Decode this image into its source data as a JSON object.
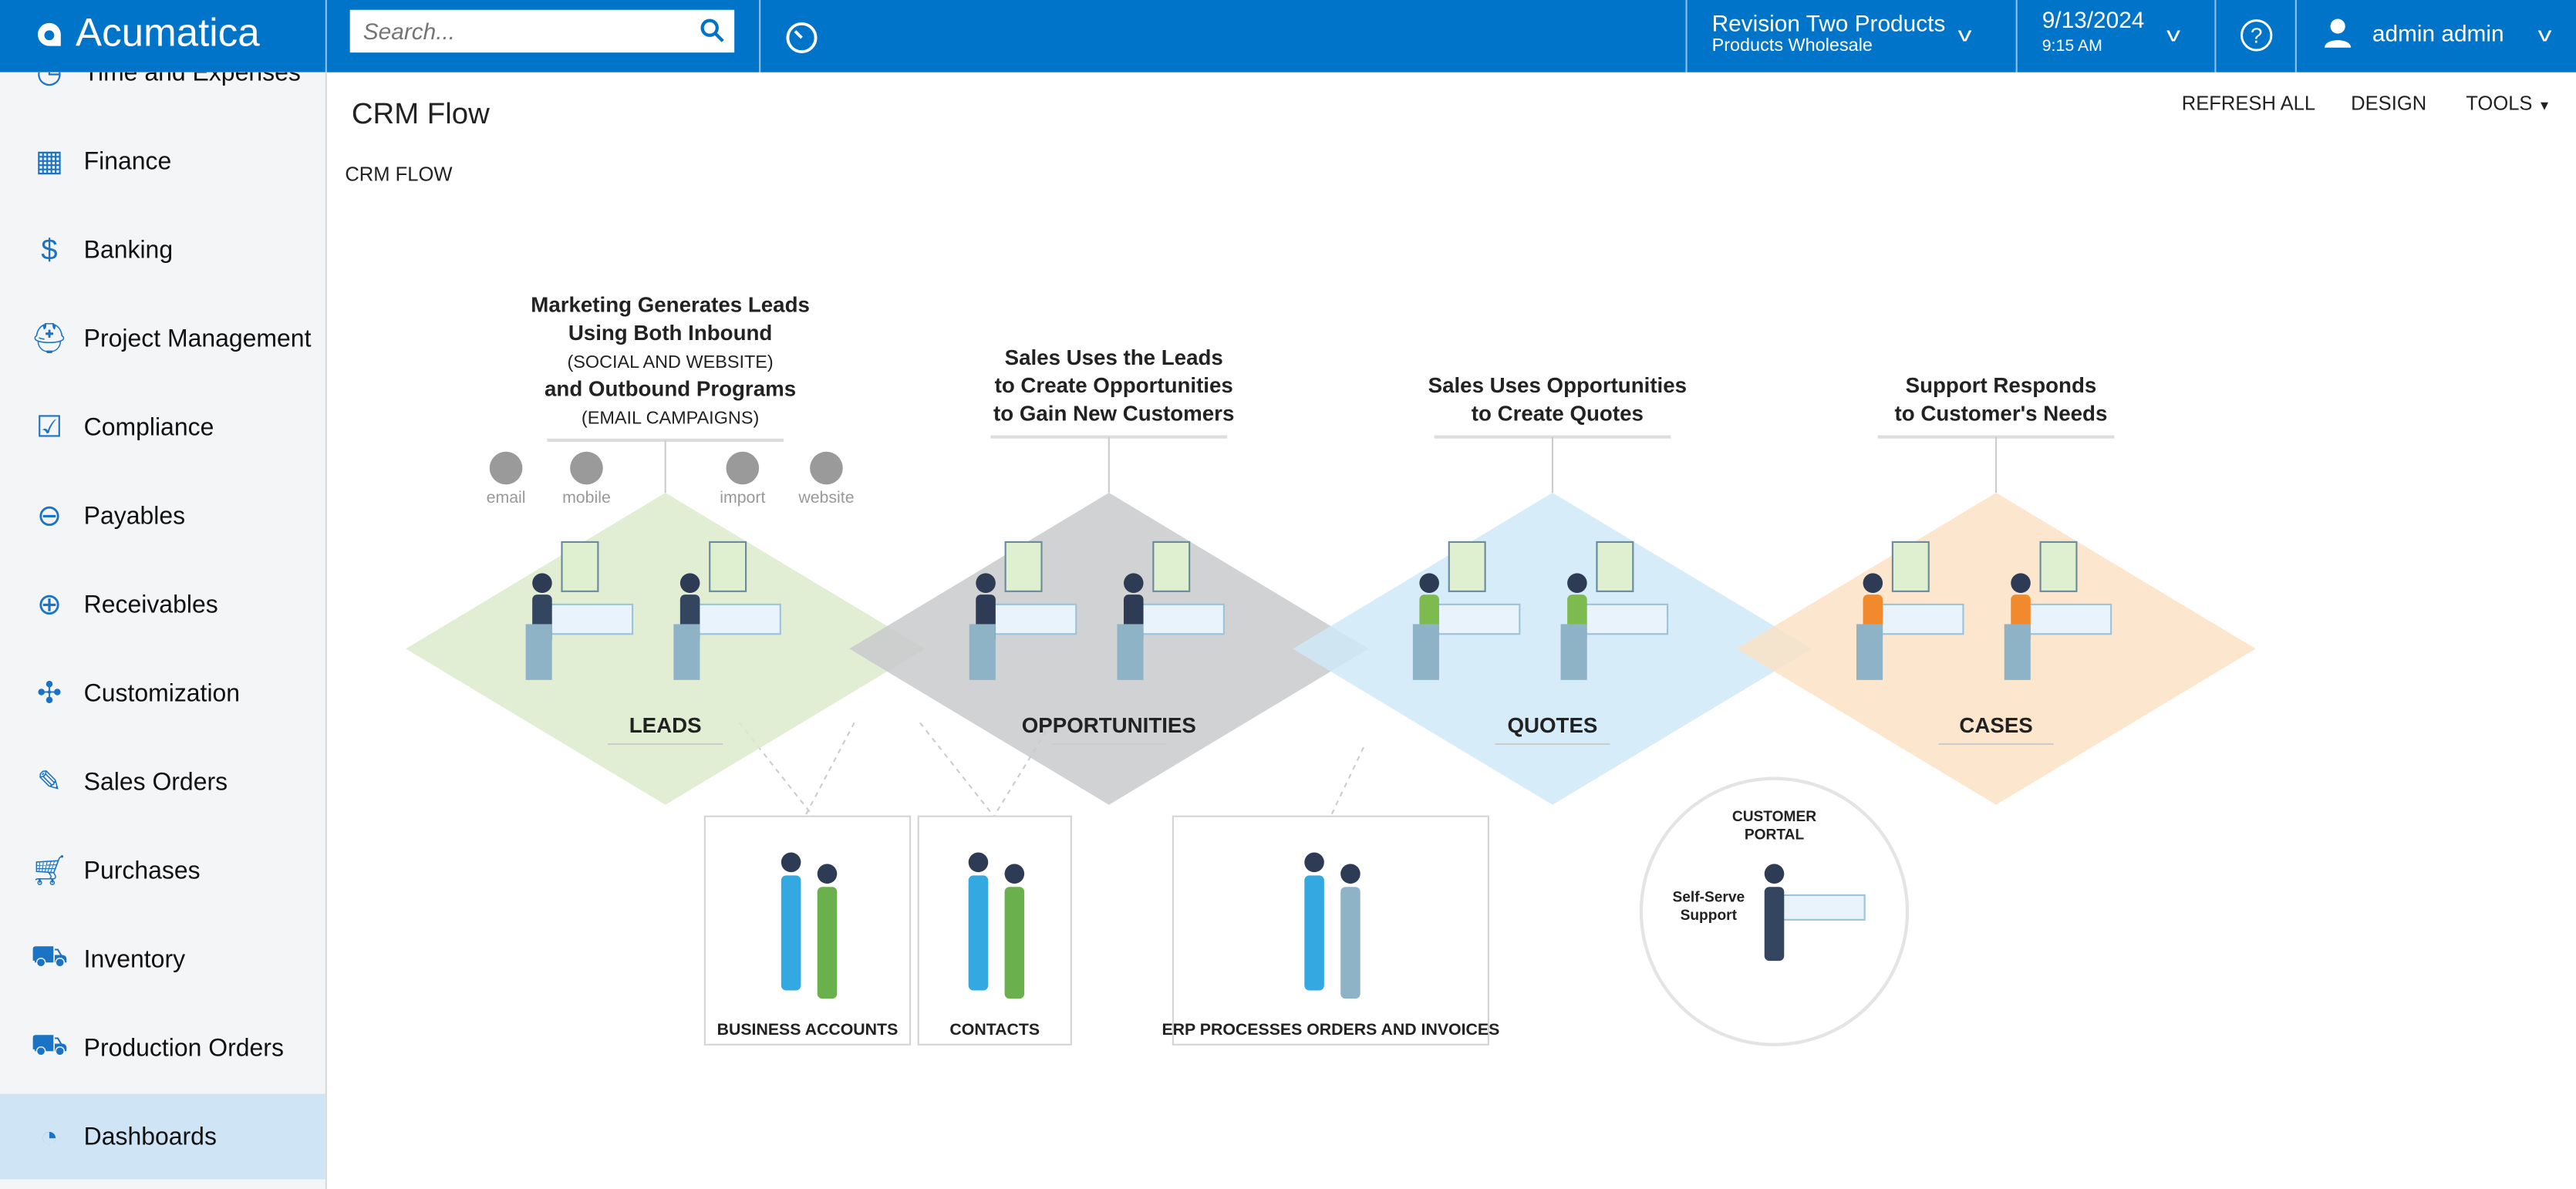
{
  "header": {
    "logo": "Acumatica",
    "search_placeholder": "Search...",
    "company": "Revision Two Products",
    "branch": "Products Wholesale",
    "date": "9/13/2024",
    "time": "9:15 AM",
    "user": "admin admin",
    "brand_color": "#0074c8"
  },
  "sidebar": {
    "items": [
      {
        "label": "Time and Expenses",
        "icon": "clock-icon"
      },
      {
        "label": "Finance",
        "icon": "calculator-icon"
      },
      {
        "label": "Banking",
        "icon": "dollar-icon"
      },
      {
        "label": "Project Management",
        "icon": "worker-icon"
      },
      {
        "label": "Compliance",
        "icon": "checklist-icon"
      },
      {
        "label": "Payables",
        "icon": "minus-circle-icon"
      },
      {
        "label": "Receivables",
        "icon": "plus-circle-icon"
      },
      {
        "label": "Customization",
        "icon": "puzzle-icon"
      },
      {
        "label": "Sales Orders",
        "icon": "pencil-icon"
      },
      {
        "label": "Purchases",
        "icon": "cart-icon"
      },
      {
        "label": "Inventory",
        "icon": "truck-icon"
      },
      {
        "label": "Production Orders",
        "icon": "truck-icon"
      },
      {
        "label": "Dashboards",
        "icon": "gauge-icon",
        "selected": true
      }
    ]
  },
  "page": {
    "title": "CRM Flow",
    "toolbar": {
      "refresh": "REFRESH ALL",
      "design": "DESIGN",
      "tools": "TOOLS"
    },
    "widget_title": "CRM FLOW"
  },
  "diagram": {
    "stages": [
      {
        "label": "LEADS",
        "heading": [
          "Marketing Generates Leads",
          "Using Both Inbound",
          "(SOCIAL AND WEBSITE)",
          "and Outbound Programs",
          "(EMAIL CAMPAIGNS)"
        ],
        "color": "#dcebcc"
      },
      {
        "label": "OPPORTUNITIES",
        "heading": [
          "Sales Uses the Leads",
          "to Create Opportunities",
          "to Gain New Customers"
        ],
        "color": "#c9cacc"
      },
      {
        "label": "QUOTES",
        "heading": [
          "Sales Uses Opportunities",
          "to Create Quotes"
        ],
        "color": "#cfe9f8"
      },
      {
        "label": "CASES",
        "heading": [
          "Support Responds",
          "to Customer's Needs"
        ],
        "color": "#fbe3c6"
      }
    ],
    "channels": [
      "email",
      "mobile",
      "import",
      "website"
    ],
    "boxes": [
      "BUSINESS ACCOUNTS",
      "CONTACTS",
      "ERP PROCESSES ORDERS AND INVOICES"
    ],
    "portal": {
      "title": [
        "CUSTOMER",
        "PORTAL"
      ],
      "sub": [
        "Self-Serve",
        "Support"
      ]
    }
  }
}
